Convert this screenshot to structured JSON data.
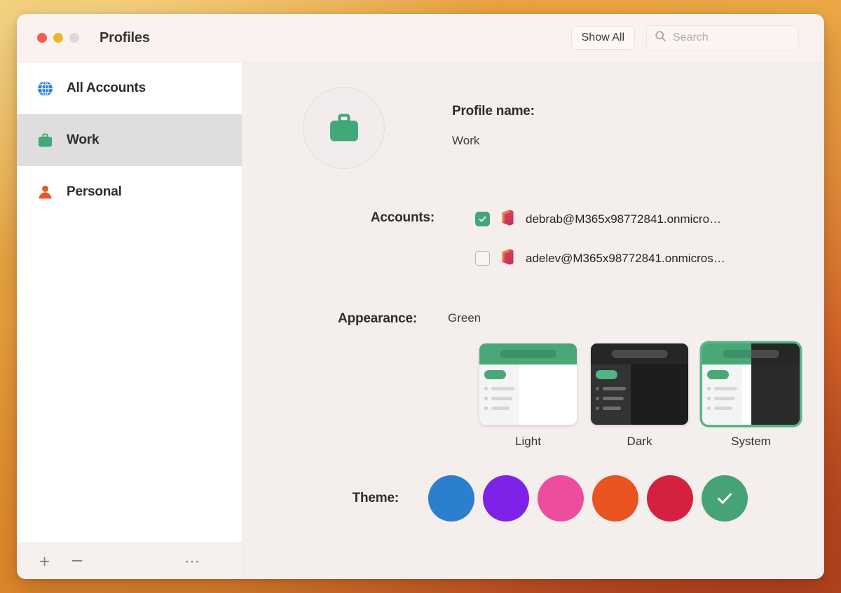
{
  "window": {
    "title": "Profiles",
    "traffic_lights": [
      "close",
      "minimize",
      "maximize"
    ]
  },
  "toolbar": {
    "show_all_label": "Show All",
    "search_placeholder": "Search"
  },
  "sidebar": {
    "items": [
      {
        "label": "All Accounts",
        "icon": "globe-icon",
        "selected": false,
        "color": "#2f7ed8"
      },
      {
        "label": "Work",
        "icon": "briefcase-icon",
        "selected": true,
        "color": "#41a877"
      },
      {
        "label": "Personal",
        "icon": "person-icon",
        "selected": false,
        "color": "#e9562c"
      }
    ],
    "footer": {
      "add_label": "+",
      "remove_label": "−",
      "more_label": "⋯"
    }
  },
  "profile": {
    "avatar_icon": "briefcase-icon",
    "name_label": "Profile name:",
    "name_value": "Work"
  },
  "accounts": {
    "label": "Accounts:",
    "rows": [
      {
        "email": "debrab@M365x98772841.onmicro…",
        "checked": true,
        "icon": "office-icon"
      },
      {
        "email": "adelev@M365x98772841.onmicros…",
        "checked": false,
        "icon": "office-icon"
      }
    ]
  },
  "appearance": {
    "label": "Appearance:",
    "value": "Green",
    "options": [
      {
        "label": "Light",
        "selected": false
      },
      {
        "label": "Dark",
        "selected": false
      },
      {
        "label": "System",
        "selected": true
      }
    ]
  },
  "theme": {
    "label": "Theme:",
    "selected_index": 5,
    "swatches": [
      {
        "name": "blue",
        "color": "#2b7fce"
      },
      {
        "name": "purple",
        "color": "#7e22e8"
      },
      {
        "name": "pink",
        "color": "#ed4d9c"
      },
      {
        "name": "orange",
        "color": "#e9531f"
      },
      {
        "name": "red",
        "color": "#d5213f"
      },
      {
        "name": "green",
        "color": "#46a277"
      }
    ]
  },
  "colors": {
    "accent_green": "#43a578",
    "window_bg": "#ffffff",
    "content_bg": "#f4eeec",
    "titlebar_bg": "#fbf2f0",
    "sidebar_selected": "#dfdddd"
  }
}
